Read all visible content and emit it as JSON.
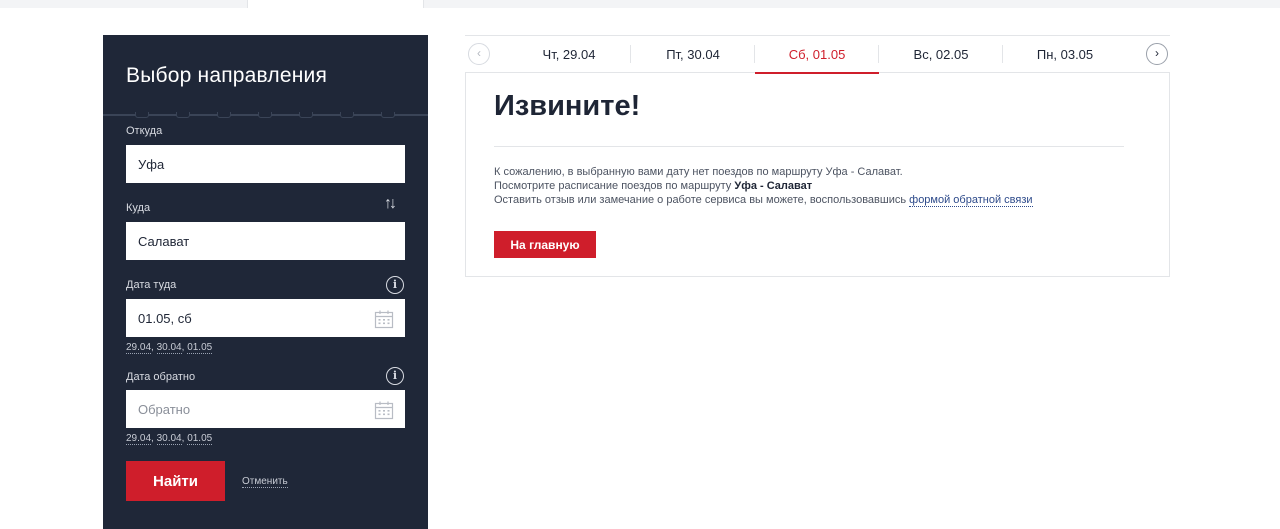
{
  "sidebar": {
    "title": "Выбор направления",
    "from_label": "Откуда",
    "from_value": "Уфа",
    "to_label": "Куда",
    "to_value": "Салават",
    "depart_label": "Дата туда",
    "depart_value": "01.05, сб",
    "depart_quick": [
      "29.04",
      "30.04",
      "01.05"
    ],
    "return_label": "Дата обратно",
    "return_placeholder": "Обратно",
    "return_quick": [
      "29.04",
      "30.04",
      "01.05"
    ],
    "find_label": "Найти",
    "cancel_label": "Отменить"
  },
  "date_tabs": {
    "items": [
      "Чт, 29.04",
      "Пт, 30.04",
      "Сб, 01.05",
      "Вс, 02.05",
      "Пн, 03.05"
    ],
    "active_index": 2
  },
  "content": {
    "title": "Извините!",
    "line1": "К сожалению, в выбранную вами дату нет поездов по маршруту Уфа - Салават.",
    "line2_prefix": "Посмотрите расписание поездов по маршруту ",
    "line2_route": "Уфа - Салават",
    "line3_prefix": "Оставить отзыв или замечание о работе сервиса вы можете, воспользовавшись ",
    "line3_link": "формой обратной связи",
    "home_button": "На главную"
  },
  "icons": {
    "swap": "swap-arrows-icon",
    "info": "info-icon",
    "calendar": "calendar-icon",
    "prev": "chevron-left-icon",
    "next": "chevron-right-icon"
  },
  "colors": {
    "accent": "#cf1e2b",
    "sidebar_bg": "#1f2738",
    "link": "#2d4a8a"
  }
}
